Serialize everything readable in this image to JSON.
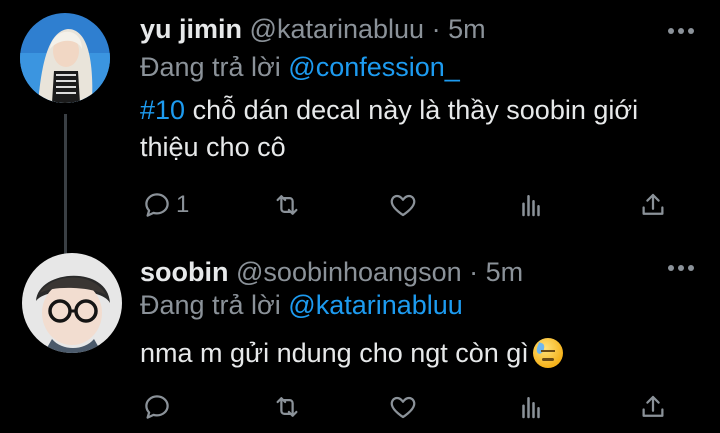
{
  "tweets": [
    {
      "name": "yu jimin",
      "handle": "@katarinabluu",
      "separator": "·",
      "time": "5m",
      "reply_prefix": "Đang trả lời",
      "reply_to": "@confession_",
      "hashtag": "#10",
      "text": " chỗ dán decal này là thầy soobin giới thiệu cho cô",
      "reply_count": "1",
      "avatar_icon": "blonde-girl-avatar"
    },
    {
      "name": "soobin",
      "handle": "@soobinhoangson",
      "separator": "·",
      "time": "5m",
      "reply_prefix": "Đang trả lời",
      "reply_to": "@katarinabluu",
      "text": "nma m gửi ndung cho ngt còn gì",
      "reply_count": "",
      "avatar_icon": "boy-with-glasses-avatar",
      "emoji": "sweat-smile-emoji"
    }
  ],
  "colors": {
    "background": "#000000",
    "text": "#e7e9ea",
    "secondary": "#8b9299",
    "link": "#1d9bf0",
    "thread_line": "#3a3f44"
  }
}
